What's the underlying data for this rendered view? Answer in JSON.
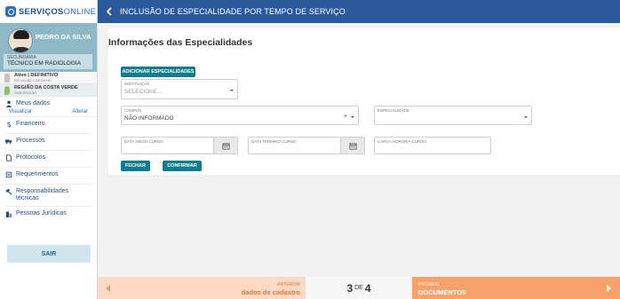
{
  "app": {
    "logo_primary": "SERVIÇOS",
    "logo_secondary": "ONLINE"
  },
  "header": {
    "title": "INCLUSÃO DE ESPECIALIDADE POR TEMPO DE SERVIÇO"
  },
  "profile": {
    "name": "PEDRO DA SILVA",
    "role_label": "SECUNDÁRIA",
    "role_value": "TÉCNICO EM RADIOLOGIA",
    "status_main": "Ativo | DEFINITIVO",
    "status_sub": "SITUAÇÃO | DETALHE",
    "region_main": "REGIÃO DA COSTA VERDE",
    "region_sub": "SUB-REGIÃO"
  },
  "sidebar": {
    "meus_dados": "Meus dados",
    "visualizar": "Visualizar",
    "alterar": "Alterar",
    "items": [
      {
        "label": "Financeiro",
        "icon": "dollar-icon"
      },
      {
        "label": "Processos",
        "icon": "truck-icon"
      },
      {
        "label": "Protocolos",
        "icon": "file-icon"
      },
      {
        "label": "Requerimentos",
        "icon": "form-icon"
      },
      {
        "label": "Responsabilidades técnicas",
        "icon": "gavel-icon"
      },
      {
        "label": "Pessoas Jurídicas",
        "icon": "building-icon"
      }
    ],
    "logout": "SAIR"
  },
  "main": {
    "section_title": "Informações das Especialidades",
    "add_button": "ADICIONAR ESPECIALIDADES",
    "instituicao_label": "INSTITUIÇÃO",
    "instituicao_placeholder": "SELECIONE...",
    "campus_label": "CAMPUS",
    "campus_value": "NÃO INFORMADO",
    "especialidade_label": "ESPECIALIDADE",
    "especialidade_value": "",
    "data_inicio_label": "DATA INÍCIO CURSO",
    "data_termino_label": "DATA TÉRMINO CURSO",
    "carga_horaria_label": "CARGA HORÁRIA CURSO",
    "fechar_button": "FECHAR",
    "confirmar_button": "CONFIRMAR"
  },
  "footer": {
    "prev_small": "ANTERIOR",
    "prev_big": "dados de cadastro",
    "current_step": "3",
    "of_label": "DE",
    "total_steps": "4",
    "next_small": "PRÓXIMO",
    "next_big": "DOCUMENTOS"
  },
  "colors": {
    "header_bg": "#2a5a9b",
    "button_bg": "#0f7d8c",
    "profile_bg": "#8fb8c7",
    "prev_bg": "#fcd9c5",
    "next_bg": "#f6a26b"
  }
}
